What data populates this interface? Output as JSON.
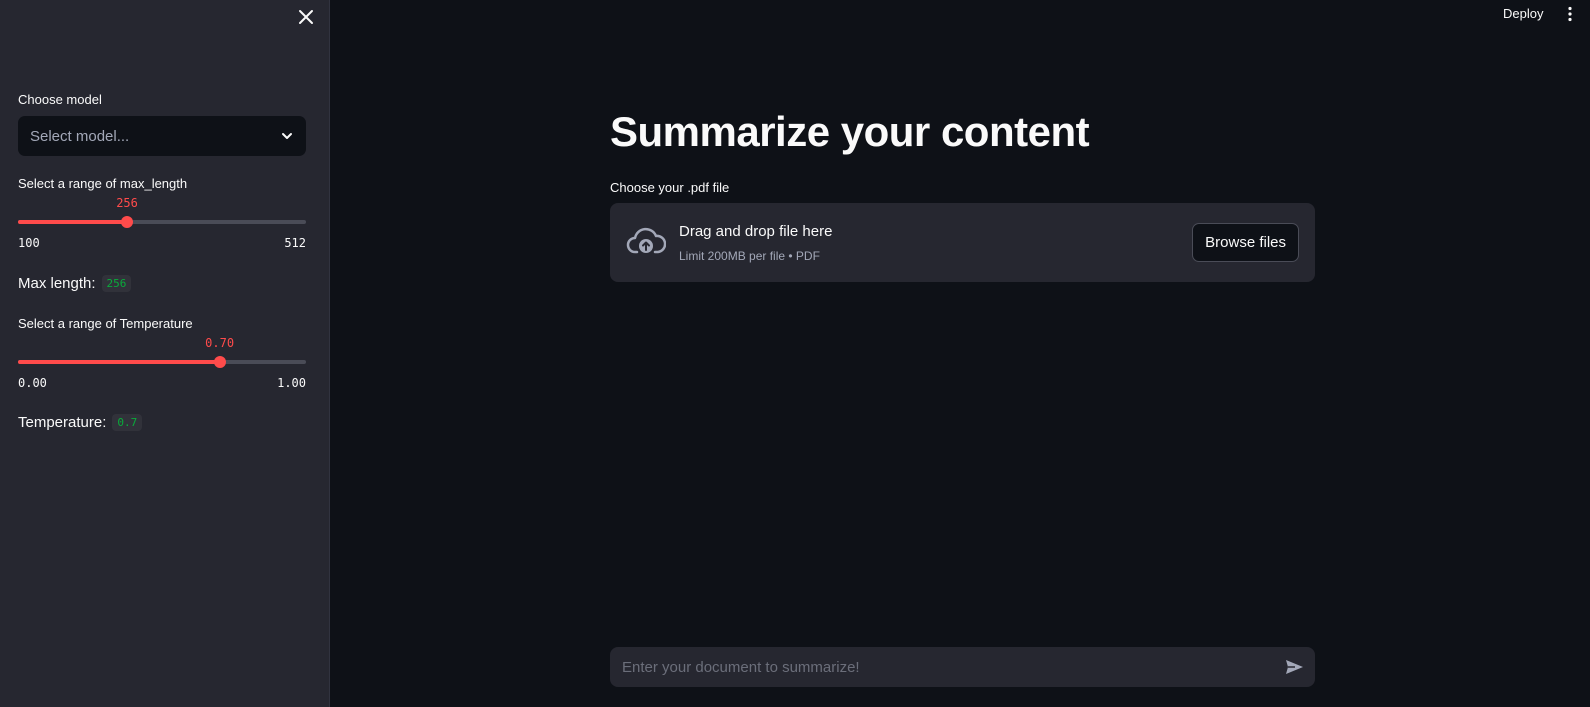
{
  "sidebar": {
    "model_select": {
      "label": "Choose model",
      "placeholder": "Select model..."
    },
    "max_length_slider": {
      "label": "Select a range of max_length",
      "value": "256",
      "value_num": 256,
      "min": "100",
      "max": "512",
      "min_num": 100,
      "max_num": 512
    },
    "max_length_metric": {
      "label": "Max length:",
      "value": "256"
    },
    "temperature_slider": {
      "label": "Select a range of Temperature",
      "value": "0.70",
      "value_num": 0.7,
      "min": "0.00",
      "max": "1.00",
      "min_num": 0,
      "max_num": 1
    },
    "temperature_metric": {
      "label": "Temperature:",
      "value": "0.7"
    }
  },
  "header": {
    "deploy_label": "Deploy"
  },
  "main": {
    "title": "Summarize your content",
    "uploader": {
      "label": "Choose your .pdf file",
      "drop_text": "Drag and drop file here",
      "limit_text": "Limit 200MB per file • PDF",
      "button_label": "Browse files"
    },
    "chat": {
      "placeholder": "Enter your document to summarize!"
    }
  },
  "colors": {
    "accent": "#ff4b4b",
    "background": "#0e1117",
    "sidebar": "#262730",
    "code_green": "#09ab3b"
  },
  "icons": {
    "close": "close-icon",
    "chevron": "chevron-down-icon",
    "kebab": "vertical-dots-icon",
    "upload": "cloud-upload-icon",
    "send": "send-icon"
  }
}
